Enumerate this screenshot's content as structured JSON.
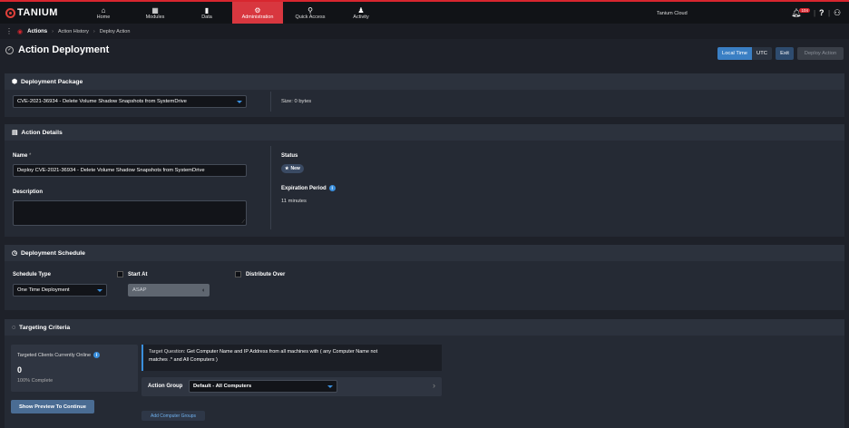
{
  "app": {
    "logo": "TANIUM"
  },
  "nav": [
    {
      "label": "Home",
      "icon": "home-icon",
      "glyph": "⌂"
    },
    {
      "label": "Modules",
      "icon": "grid-icon",
      "glyph": "▦"
    },
    {
      "label": "Data",
      "icon": "bar-chart-icon",
      "glyph": "▮"
    },
    {
      "label": "Administration",
      "icon": "gears-icon",
      "glyph": "⚙"
    },
    {
      "label": "Quick Access",
      "icon": "link-icon",
      "glyph": "⚲"
    },
    {
      "label": "Activity",
      "icon": "bell-icon",
      "glyph": "♟"
    }
  ],
  "topright": {
    "tenant": "Tanium Cloud",
    "notif_count": "104",
    "help": "?",
    "user": "⚇"
  },
  "breadcrumb": {
    "home": "Actions",
    "items": [
      "Action History",
      "Deploy Action"
    ]
  },
  "page": {
    "title": "Action Deployment",
    "local_time": "Local Time",
    "utc": "UTC",
    "exit": "Exit",
    "deploy": "Deploy Action"
  },
  "package": {
    "header": "Deployment Package",
    "selected": "CVE-2021-36934 - Delete Volume Shadow Snapshots from SystemDrive",
    "size": "Size:  0 bytes"
  },
  "details": {
    "header": "Action Details",
    "name_label": "Name",
    "required_mark": "*",
    "name_value": "Deploy CVE-2021-36934 - Delete Volume Shadow Snapshots from SystemDrive",
    "description_label": "Description",
    "status_label": "Status",
    "status_value": "New",
    "expiration_label": "Expiration Period",
    "expiration_value": "11 minutes"
  },
  "schedule": {
    "header": "Deployment Schedule",
    "type_label": "Schedule Type",
    "type_value": "One Time Deployment",
    "start_at": "Start At",
    "start_value": "ASAP",
    "distribute": "Distribute Over"
  },
  "targeting": {
    "header": "Targeting Criteria",
    "online_label": "Targeted Clients Currently Online",
    "online_count": "0",
    "complete": "100% Complete",
    "preview_button": "Show Preview To Continue",
    "question_prefix": "Target Question:",
    "question_line1": "Get Computer Name and IP Address from all machines with ( any Computer Name not",
    "question_line2": "matches .* and All Computers )",
    "group_label": "Action Group",
    "group_value": "Default - All Computers",
    "add_groups": "Add Computer Groups"
  },
  "colors": {
    "accent": "#d8262f",
    "link": "#3a8fdd",
    "panel": "#252a34",
    "bg": "#1e2129"
  }
}
